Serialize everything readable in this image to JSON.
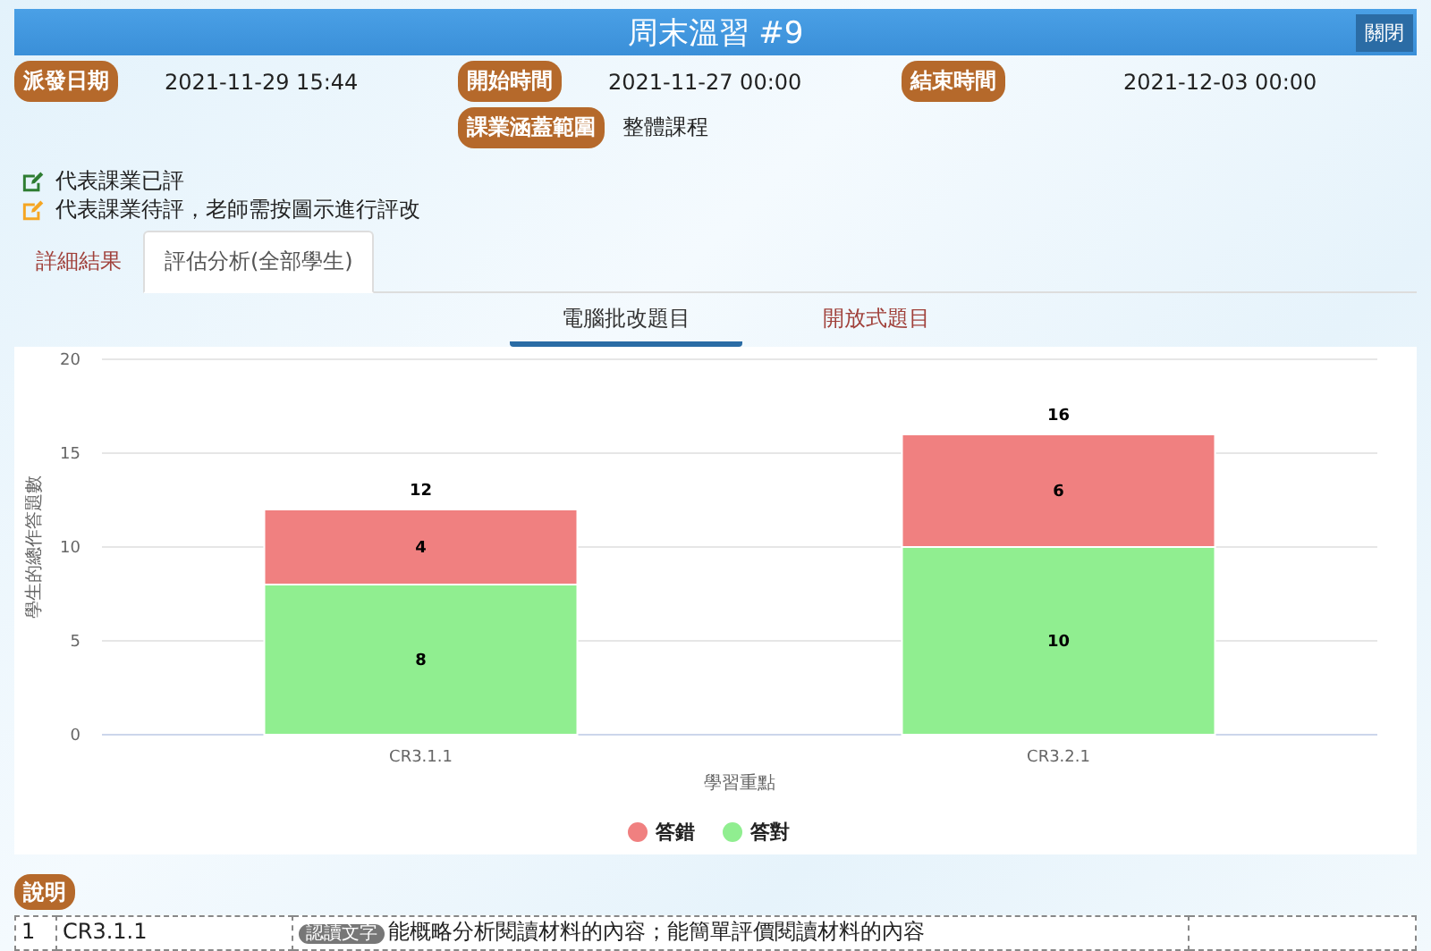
{
  "window": {
    "title": "周末溫習 #9",
    "close_button": "關閉"
  },
  "info": [
    {
      "label": "派發日期",
      "value": "2021-11-29 15:44"
    },
    {
      "label": "開始時間",
      "value": "2021-11-27 00:00"
    },
    {
      "label": "結束時間",
      "value": "2021-12-03 00:00"
    },
    {
      "label": "課業涵蓋範圍",
      "value": "整體課程"
    }
  ],
  "legend_notes": [
    {
      "kind": "graded",
      "text": "代表課業已評"
    },
    {
      "kind": "pending",
      "text": "代表課業待評，老師需按圖示進行評改"
    }
  ],
  "tabs": [
    {
      "label": "詳細結果",
      "selected": false
    },
    {
      "label": "評估分析(全部學生)",
      "selected": true
    }
  ],
  "subtabs": [
    {
      "label": "電腦批改題目",
      "selected": true
    },
    {
      "label": "開放式題目",
      "selected": false
    }
  ],
  "chart_data": {
    "type": "bar",
    "stacked": true,
    "xlabel": "學習重點",
    "ylabel": "學生的總作答題數",
    "categories": [
      "CR3.1.1",
      "CR3.2.1"
    ],
    "series": [
      {
        "name": "答對",
        "color": "#90ee90",
        "values": [
          8,
          10
        ]
      },
      {
        "name": "答錯",
        "color": "#f08080",
        "values": [
          4,
          6
        ]
      }
    ],
    "ylim": [
      0,
      20
    ],
    "yticks": [
      0,
      5,
      10,
      15,
      20
    ],
    "data_labels": true,
    "grid": true,
    "totals": [
      "12",
      "16"
    ]
  },
  "explanation_label": "說明",
  "table": {
    "rows": [
      {
        "index": "1",
        "code": "CR3.1.1",
        "tag": "認讀文字",
        "description": "能概略分析閱讀材料的內容；能簡單評價閱讀材料的內容"
      }
    ]
  }
}
